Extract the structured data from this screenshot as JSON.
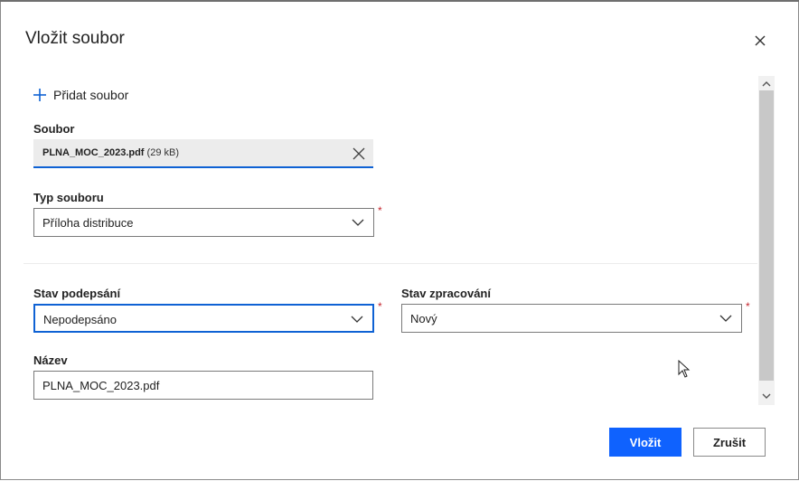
{
  "dialog": {
    "title": "Vložit soubor",
    "close_icon": "close-icon"
  },
  "add_file": {
    "label": "Přidat soubor",
    "icon": "plus-icon"
  },
  "file": {
    "label": "Soubor",
    "name": "PLNA_MOC_2023.pdf",
    "size": "(29 kB)"
  },
  "file_type": {
    "label": "Typ souboru",
    "value": "Příloha distribuce",
    "required": "*"
  },
  "sign_state": {
    "label": "Stav podepsání",
    "value": "Nepodepsáno",
    "required": "*"
  },
  "processing_state": {
    "label": "Stav zpracování",
    "value": "Nový",
    "required": "*"
  },
  "name": {
    "label": "Název",
    "value": "PLNA_MOC_2023.pdf"
  },
  "buttons": {
    "insert": "Vložit",
    "cancel": "Zrušit"
  },
  "colors": {
    "accent": "#0f62fe",
    "required": "#c4262e",
    "file_box_bg": "#ececec"
  }
}
